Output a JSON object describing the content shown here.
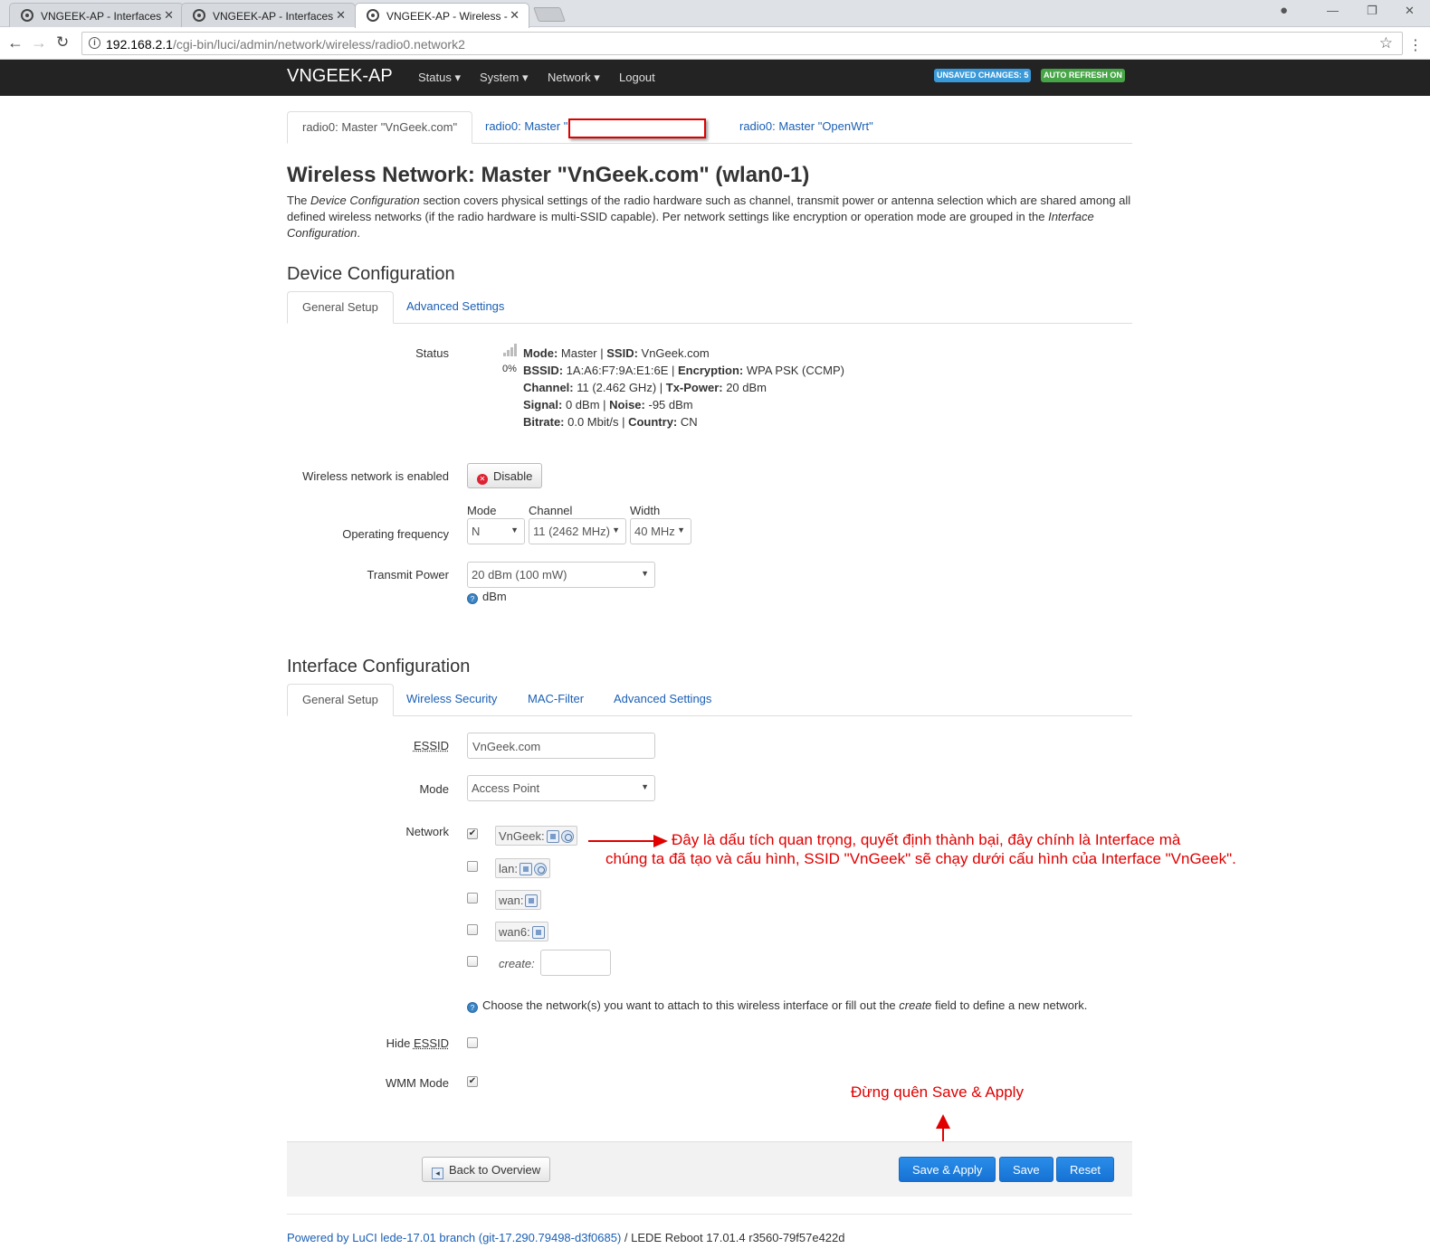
{
  "browser": {
    "tabs": [
      {
        "title": "VNGEEK-AP - Interfaces -"
      },
      {
        "title": "VNGEEK-AP - Interfaces"
      },
      {
        "title": "VNGEEK-AP - Wireless - L"
      }
    ],
    "url_host": "192.168.2.1",
    "url_path": "/cgi-bin/luci/admin/network/wireless/radio0.network2"
  },
  "header": {
    "brand": "VNGEEK-AP",
    "nav": [
      "Status ▾",
      "System ▾",
      "Network ▾",
      "Logout"
    ],
    "badge_unsaved": "UNSAVED CHANGES: 5",
    "badge_refresh": "AUTO REFRESH ON",
    "colors": {
      "bar": "#232323",
      "unsaved": "#3a9ad9",
      "refresh": "#46a546"
    }
  },
  "network_tabs": {
    "tab1": "radio0: Master \"VnGeek.com\"",
    "tab2": "radio0: Master \"",
    "tab3": "radio0: Master \"OpenWrt\""
  },
  "page": {
    "title": "Wireless Network: Master \"VnGeek.com\" (wlan0-1)",
    "desc_1": "The ",
    "desc_em1": "Device Configuration",
    "desc_2": " section covers physical settings of the radio hardware such as channel, transmit power or antenna selection which are shared among all defined wireless networks (if the radio hardware is multi-SSID capable). Per network settings like encryption or operation mode are grouped in the ",
    "desc_em2": "Interface Configuration",
    "desc_3": "."
  },
  "device": {
    "heading": "Device Configuration",
    "tab_general": "General Setup",
    "tab_advanced": "Advanced Settings",
    "status_label": "Status",
    "signal_pct": "0%",
    "status": {
      "l1": [
        {
          "k": "Mode:",
          "v": " Master | "
        },
        {
          "k": "SSID:",
          "v": " VnGeek.com"
        }
      ],
      "l2": [
        {
          "k": "BSSID:",
          "v": " 1A:A6:F7:9A:E1:6E | "
        },
        {
          "k": "Encryption:",
          "v": " WPA PSK (CCMP)"
        }
      ],
      "l3": [
        {
          "k": "Channel:",
          "v": " 11 (2.462 GHz) | "
        },
        {
          "k": "Tx-Power:",
          "v": " 20 dBm"
        }
      ],
      "l4": [
        {
          "k": "Signal:",
          "v": " 0 dBm | "
        },
        {
          "k": "Noise:",
          "v": " -95 dBm"
        }
      ],
      "l5": [
        {
          "k": "Bitrate:",
          "v": " 0.0 Mbit/s | "
        },
        {
          "k": "Country:",
          "v": " CN"
        }
      ]
    },
    "enabled_label": "Wireless network is enabled",
    "disable_btn": "Disable",
    "freq_label": "Operating frequency",
    "mode_label": "Mode",
    "channel_label": "Channel",
    "width_label": "Width",
    "mode_value": "N",
    "channel_value": "11 (2462 MHz)",
    "width_value": "40 MHz",
    "txpower_label": "Transmit Power",
    "txpower_value": "20 dBm (100 mW)",
    "txpower_help": "dBm"
  },
  "iface": {
    "heading": "Interface Configuration",
    "tab_general": "General Setup",
    "tab_security": "Wireless Security",
    "tab_mac": "MAC-Filter",
    "tab_advanced": "Advanced Settings",
    "essid_label": "ESSID",
    "essid_value": "VnGeek.com",
    "mode_label": "Mode",
    "mode_value": "Access Point",
    "network_label": "Network",
    "networks": [
      {
        "name": "VnGeek:",
        "checked": true
      },
      {
        "name": "lan:",
        "checked": false
      },
      {
        "name": "wan:",
        "checked": false
      },
      {
        "name": "wan6:",
        "checked": false
      }
    ],
    "create_label": "create:",
    "network_help_1": "Choose the network(s) you want to attach to this wireless interface or fill out the ",
    "network_help_em": "create",
    "network_help_2": " field to define a new network.",
    "hide_label": "Hide ",
    "hide_label_abbr": "ESSID",
    "wmm_label": "WMM Mode"
  },
  "annotation": {
    "line1": "Đây là dấu tích quan trọng, quyết định thành bại, đây chính là Interface mà",
    "line2": "chúng ta đã tạo và cấu hình, SSID \"VnGeek\" sẽ chạy dưới cấu hình của Interface \"VnGeek\".",
    "save_note": "Đừng quên Save & Apply"
  },
  "actions": {
    "back": "Back to Overview",
    "save_apply": "Save & Apply",
    "save": "Save",
    "reset": "Reset"
  },
  "footer": {
    "powered": "Powered by LuCI lede-17.01 branch (git-17.290.79498-d3f0685)",
    "rest": " / LEDE Reboot 17.01.4 r3560-79f57e422d"
  }
}
